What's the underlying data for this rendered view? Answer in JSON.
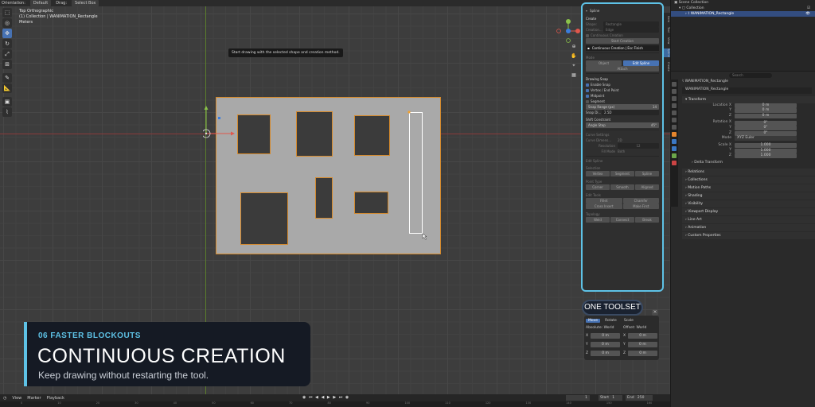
{
  "topbar": {
    "orientation_label": "Orientation:",
    "orientation_value": "Default",
    "drag_label": "Drag:",
    "drag_value": "Select Box"
  },
  "overlay": {
    "view_name": "Top Orthographic",
    "collection": "(1) Collection | WANIMATION_Rectangle",
    "units": "Meters"
  },
  "toolbar": {
    "tools": [
      "select-icon",
      "cursor-icon",
      "move-icon",
      "rotate-icon",
      "scale-icon",
      "transform-icon",
      "annotate-icon",
      "measure-icon",
      "add-cube-icon",
      "spline-icon"
    ]
  },
  "tooltip": "Start drawing with the selected shape and creation method.",
  "npanel": {
    "title": "Spline",
    "create_header": "Create",
    "shape_label": "Shape:",
    "shape_value": "Rectangle",
    "creation_label": "Creation...",
    "creation_value": "Edge",
    "continuous_chk": "Continuous Creation",
    "start_btn": "Start Creation",
    "continuous_status": "Continuous Creation | Esc Finish",
    "mode_header": "Mode",
    "mode_object": "Object",
    "mode_edit": "Edit Spline",
    "attach_btn": "Attach",
    "drawing_snap_header": "Drawing Snap",
    "enable_snap": "Enable Snap",
    "vertex_endpoint": "Vertex / End Point",
    "midpoint": "Midpoint",
    "segment": "Segment",
    "snap_range_label": "Snap Range (px)",
    "snap_range_value": "14",
    "snap_di_label": "Snap Di...",
    "snap_di_value": "2.5D",
    "shift_constraint": "Shift Constraint",
    "angle_step_label": "Angle Step",
    "angle_step_value": "45°",
    "curve_settings": "Curve Settings",
    "curve_dimens": "Curve Dimens...",
    "curve_dimens_value": "2D",
    "resolution_label": "Resolution",
    "resolution_value": "12",
    "fill_mode_label": "Fill Mode",
    "fill_mode_value": "Both",
    "edit_spline": "Edit Spline",
    "selection": "Selection",
    "sel_vertex": "Vertex",
    "sel_segment": "Segment",
    "sel_spline": "Spline",
    "point_type": "Point Type",
    "pt_corner": "Corner",
    "pt_smooth": "Smooth",
    "pt_aligned": "Aligned",
    "edit_tools": "Edit Tools",
    "fillet": "Fillet",
    "chamfer": "Chamfer",
    "cross_insert": "Cross Insert",
    "make_first": "Make First",
    "topology": "Topology",
    "weld": "Weld",
    "connect": "Connect",
    "break": "Break"
  },
  "sidetabs": [
    "Item",
    "Tool",
    "View",
    "Spline",
    "Create"
  ],
  "onetoolset_label": "ONE TOOLSET",
  "transform_panel": {
    "tabs": [
      "Move",
      "Rotate",
      "Scale"
    ],
    "abs_header": "Absolute: World",
    "off_header": "Offset: World",
    "abs": [
      {
        "axis": "X",
        "value": "0 m"
      },
      {
        "axis": "Y",
        "value": "0 m"
      },
      {
        "axis": "Z",
        "value": "0 m"
      }
    ],
    "off": [
      {
        "axis": "X",
        "value": "0 m"
      },
      {
        "axis": "Y",
        "value": "0 m"
      },
      {
        "axis": "Z",
        "value": "0 m"
      }
    ]
  },
  "banner": {
    "subtitle": "06  FASTER BLOCKOUTS",
    "title": "CONTINUOUS CREATION",
    "desc": "Keep drawing without restarting the tool."
  },
  "timeline": {
    "view": "View",
    "marker": "Marker",
    "playback": "Playback",
    "current_frame": "1",
    "start_label": "Start",
    "start_value": "1",
    "end_label": "End",
    "end_value": "250",
    "ruler": [
      "0",
      "10",
      "20",
      "30",
      "40",
      "50",
      "60",
      "70",
      "80",
      "90",
      "100",
      "110",
      "120",
      "130",
      "140",
      "150",
      "160"
    ]
  },
  "outliner": {
    "scene_collection": "Scene Collection",
    "collection": "Collection",
    "object": "WANIMATION_Rectangle"
  },
  "properties": {
    "search_placeholder": "Search",
    "object_name": "WANIMATION_Rectangle",
    "object_field": "WANIMATION_Rectangle",
    "transform": "Transform",
    "location_label": "Location X",
    "loc": [
      "0 m",
      "0 m",
      "0 m"
    ],
    "rotation_label": "Rotation X",
    "rot": [
      "0°",
      "0°",
      "0°"
    ],
    "mode_label": "Mode",
    "mode_value": "XYZ Euler",
    "scale_label": "Scale X",
    "scale": [
      "1.000",
      "1.000",
      "1.000"
    ],
    "delta": "Delta Transform",
    "sections": [
      "Relations",
      "Collections",
      "Motion Paths",
      "Shading",
      "Visibility",
      "Viewport Display",
      "Line Art",
      "Animation",
      "Custom Properties"
    ]
  },
  "colors": {
    "accent": "#5ec2e6",
    "selection": "#d58a2c",
    "active_tool": "#4772b3",
    "banner_bg": "#151a24"
  }
}
